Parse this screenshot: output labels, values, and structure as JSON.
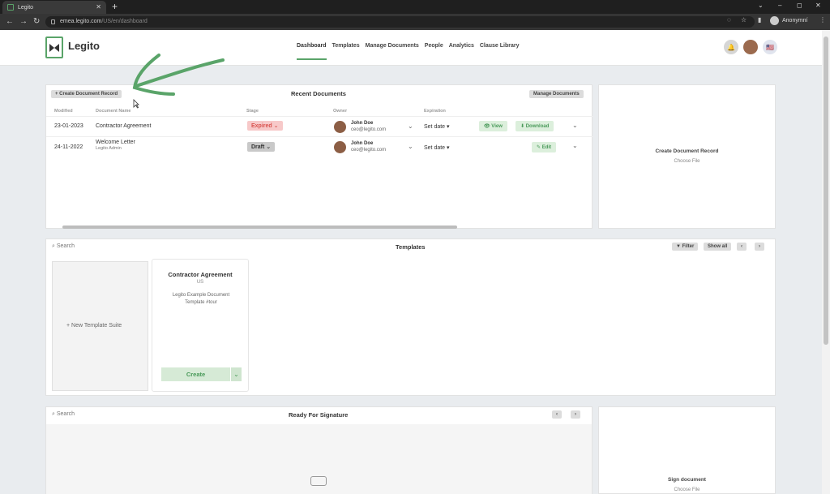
{
  "browser": {
    "tab_title": "Legito",
    "new_tab": "+",
    "url_host": "emea.legito.com",
    "url_path": "/US/en/dashboard",
    "profile": "Anonymní",
    "controls": [
      "⌄",
      "–",
      "◻",
      "✕"
    ]
  },
  "app": {
    "brand": "Legito",
    "nav": [
      "Dashboard",
      "Templates",
      "Manage Documents",
      "People",
      "Analytics",
      "Clause Library"
    ]
  },
  "recent": {
    "create_btn": "+ Create Document Record",
    "title": "Recent Documents",
    "manage_btn": "Manage Documents",
    "columns": [
      "Modified",
      "Document Name",
      "Stage",
      "Owner",
      "Expiration"
    ],
    "rows": [
      {
        "modified": "23-01-2023",
        "name": "Contractor Agreement",
        "sub": "",
        "stage": "Expired",
        "owner": "John Doe",
        "email": "ceo@legito.com",
        "expiration": "Set date",
        "actions": [
          "View",
          "Download"
        ]
      },
      {
        "modified": "24-11-2022",
        "name": "Welcome Letter",
        "sub": "Legito Admin",
        "stage": "Draft",
        "owner": "John Doe",
        "email": "ceo@legito.com",
        "expiration": "Set date",
        "actions": [
          "Edit"
        ]
      }
    ]
  },
  "create_record": {
    "title": "Create Document Record",
    "sub": "Choose File"
  },
  "templates": {
    "search": "Search",
    "title": "Templates",
    "filter": "Filter",
    "show_all": "Show all",
    "new_suite": "+ New Template Suite",
    "card": {
      "title": "Contractor Agreement",
      "region": "US",
      "desc": "Legito Example Document Template #tour",
      "create": "Create"
    }
  },
  "signature": {
    "search": "Search",
    "title": "Ready For Signature"
  },
  "sign_doc": {
    "title": "Sign document",
    "sub": "Choose File"
  },
  "colors": {
    "accent": "#5aa469",
    "expired": "#d9534f"
  }
}
